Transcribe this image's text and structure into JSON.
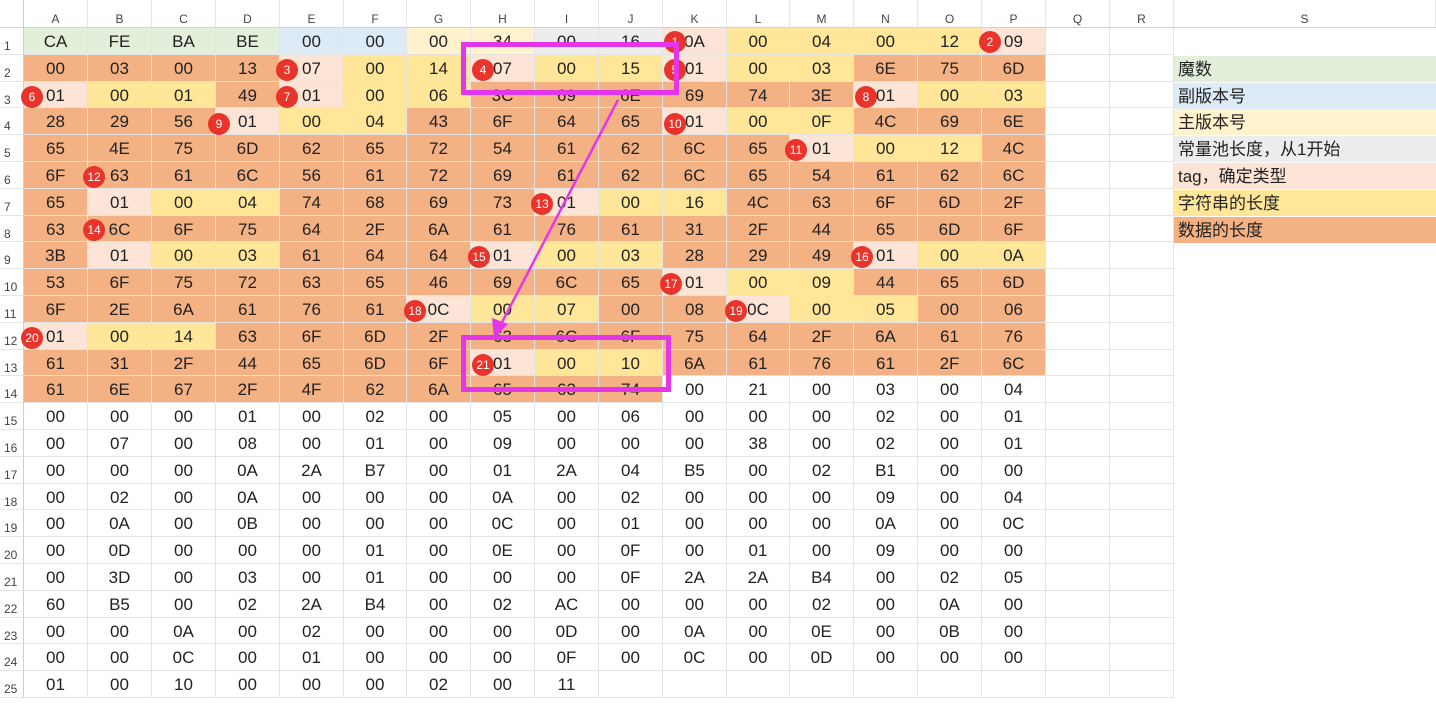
{
  "columns": [
    "A",
    "B",
    "C",
    "D",
    "E",
    "F",
    "G",
    "H",
    "I",
    "J",
    "K",
    "L",
    "M",
    "N",
    "O",
    "P",
    "Q",
    "R",
    "S"
  ],
  "rows": [
    [
      "CA",
      "FE",
      "BA",
      "BE",
      "00",
      "00",
      "00",
      "34",
      "00",
      "16",
      "0A",
      "00",
      "04",
      "00",
      "12",
      "09"
    ],
    [
      "00",
      "03",
      "00",
      "13",
      "07",
      "00",
      "14",
      "07",
      "00",
      "15",
      "01",
      "00",
      "03",
      "6E",
      "75",
      "6D"
    ],
    [
      "01",
      "00",
      "01",
      "49",
      "01",
      "00",
      "06",
      "3C",
      "69",
      "6E",
      "69",
      "74",
      "3E",
      "01",
      "00",
      "03"
    ],
    [
      "28",
      "29",
      "56",
      "01",
      "00",
      "04",
      "43",
      "6F",
      "64",
      "65",
      "01",
      "00",
      "0F",
      "4C",
      "69",
      "6E"
    ],
    [
      "65",
      "4E",
      "75",
      "6D",
      "62",
      "65",
      "72",
      "54",
      "61",
      "62",
      "6C",
      "65",
      "01",
      "00",
      "12",
      "4C"
    ],
    [
      "6F",
      "63",
      "61",
      "6C",
      "56",
      "61",
      "72",
      "69",
      "61",
      "62",
      "6C",
      "65",
      "54",
      "61",
      "62",
      "6C"
    ],
    [
      "65",
      "01",
      "00",
      "04",
      "74",
      "68",
      "69",
      "73",
      "01",
      "00",
      "16",
      "4C",
      "63",
      "6F",
      "6D",
      "2F"
    ],
    [
      "63",
      "6C",
      "6F",
      "75",
      "64",
      "2F",
      "6A",
      "61",
      "76",
      "61",
      "31",
      "2F",
      "44",
      "65",
      "6D",
      "6F"
    ],
    [
      "3B",
      "01",
      "00",
      "03",
      "61",
      "64",
      "64",
      "01",
      "00",
      "03",
      "28",
      "29",
      "49",
      "01",
      "00",
      "0A"
    ],
    [
      "53",
      "6F",
      "75",
      "72",
      "63",
      "65",
      "46",
      "69",
      "6C",
      "65",
      "01",
      "00",
      "09",
      "44",
      "65",
      "6D"
    ],
    [
      "6F",
      "2E",
      "6A",
      "61",
      "76",
      "61",
      "0C",
      "00",
      "07",
      "00",
      "08",
      "0C",
      "00",
      "05",
      "00",
      "06"
    ],
    [
      "01",
      "00",
      "14",
      "63",
      "6F",
      "6D",
      "2F",
      "63",
      "6C",
      "6F",
      "75",
      "64",
      "2F",
      "6A",
      "61",
      "76"
    ],
    [
      "61",
      "31",
      "2F",
      "44",
      "65",
      "6D",
      "6F",
      "01",
      "00",
      "10",
      "6A",
      "61",
      "76",
      "61",
      "2F",
      "6C"
    ],
    [
      "61",
      "6E",
      "67",
      "2F",
      "4F",
      "62",
      "6A",
      "65",
      "63",
      "74",
      "00",
      "21",
      "00",
      "03",
      "00",
      "04"
    ],
    [
      "00",
      "00",
      "00",
      "01",
      "00",
      "02",
      "00",
      "05",
      "00",
      "06",
      "00",
      "00",
      "00",
      "02",
      "00",
      "01"
    ],
    [
      "00",
      "07",
      "00",
      "08",
      "00",
      "01",
      "00",
      "09",
      "00",
      "00",
      "00",
      "38",
      "00",
      "02",
      "00",
      "01"
    ],
    [
      "00",
      "00",
      "00",
      "0A",
      "2A",
      "B7",
      "00",
      "01",
      "2A",
      "04",
      "B5",
      "00",
      "02",
      "B1",
      "00",
      "00"
    ],
    [
      "00",
      "02",
      "00",
      "0A",
      "00",
      "00",
      "00",
      "0A",
      "00",
      "02",
      "00",
      "00",
      "00",
      "09",
      "00",
      "04"
    ],
    [
      "00",
      "0A",
      "00",
      "0B",
      "00",
      "00",
      "00",
      "0C",
      "00",
      "01",
      "00",
      "00",
      "00",
      "0A",
      "00",
      "0C"
    ],
    [
      "00",
      "0D",
      "00",
      "00",
      "00",
      "01",
      "00",
      "0E",
      "00",
      "0F",
      "00",
      "01",
      "00",
      "09",
      "00",
      "00"
    ],
    [
      "00",
      "3D",
      "00",
      "03",
      "00",
      "01",
      "00",
      "00",
      "00",
      "0F",
      "2A",
      "2A",
      "B4",
      "00",
      "02",
      "05"
    ],
    [
      "60",
      "B5",
      "00",
      "02",
      "2A",
      "B4",
      "00",
      "02",
      "AC",
      "00",
      "00",
      "00",
      "02",
      "00",
      "0A",
      "00"
    ],
    [
      "00",
      "00",
      "0A",
      "00",
      "02",
      "00",
      "00",
      "00",
      "0D",
      "00",
      "0A",
      "00",
      "0E",
      "00",
      "0B",
      "00"
    ],
    [
      "00",
      "00",
      "0C",
      "00",
      "01",
      "00",
      "00",
      "00",
      "0F",
      "00",
      "0C",
      "00",
      "0D",
      "00",
      "00",
      "00"
    ],
    [
      "01",
      "00",
      "10",
      "00",
      "00",
      "00",
      "02",
      "00",
      "11",
      "",
      "",
      "",
      "",
      "",
      "",
      ""
    ]
  ],
  "row_numbers": [
    "1",
    "2",
    "3",
    "4",
    "5",
    "6",
    "7",
    "8",
    "9",
    "10",
    "11",
    "12",
    "13",
    "14",
    "15",
    "16",
    "17",
    "18",
    "19",
    "20",
    "21",
    "22",
    "23",
    "24",
    "25"
  ],
  "legend": [
    {
      "label": "魔数",
      "color": "#e2efda"
    },
    {
      "label": "副版本号",
      "color": "#ddebf7"
    },
    {
      "label": "主版本号",
      "color": "#fff2cc"
    },
    {
      "label": "常量池长度，从1开始",
      "color": "#ededed"
    },
    {
      "label": "tag，确定类型",
      "color": "#fce4d6"
    },
    {
      "label": "字符串的长度",
      "color": "#ffe699"
    },
    {
      "label": "数据的长度",
      "color": "#f4b183"
    }
  ],
  "badges": [
    "1",
    "2",
    "3",
    "4",
    "5",
    "6",
    "7",
    "8",
    "9",
    "10",
    "11",
    "12",
    "13",
    "14",
    "15",
    "16",
    "17",
    "18",
    "19",
    "20",
    "21"
  ],
  "colors": {
    "magic": "#e2efda",
    "minor": "#ddebf7",
    "major": "#fff2cc",
    "pool": "#ededed",
    "tag": "#fce4d6",
    "strlen": "#ffe699",
    "data": "#f4b183",
    "highlight": "#e436e8",
    "badge": "#e8342a"
  }
}
